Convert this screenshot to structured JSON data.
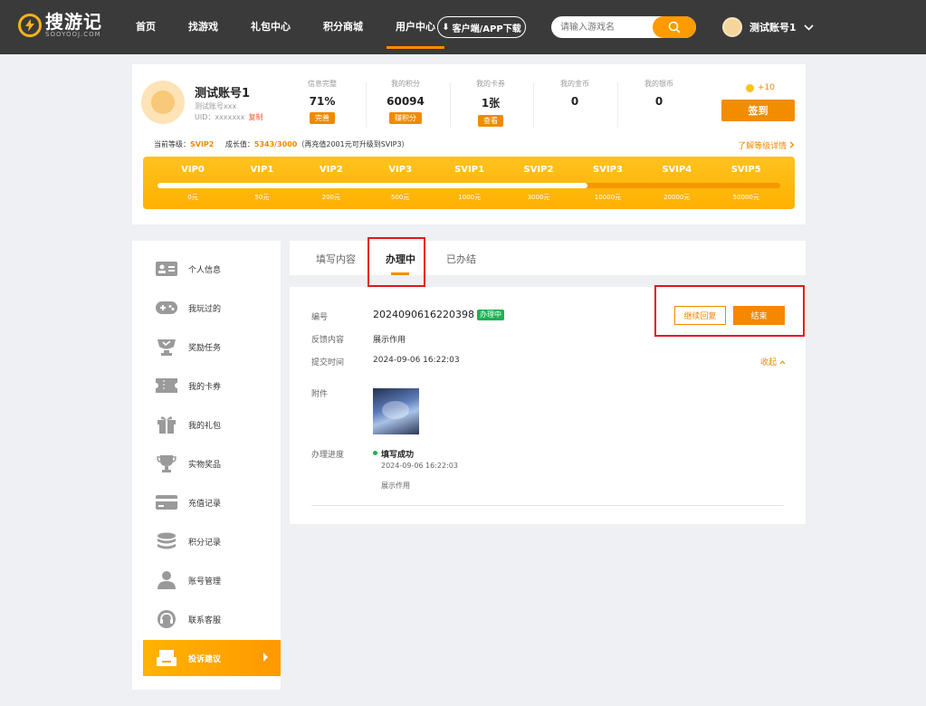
{
  "brand": {
    "name": "搜游记",
    "domain": "SOOYOOJ.COM",
    "color": "#f9b21a"
  },
  "nav": {
    "items": [
      {
        "label": "首页"
      },
      {
        "label": "找游戏"
      },
      {
        "label": "礼包中心"
      },
      {
        "label": "积分商城"
      },
      {
        "label": "用户中心",
        "active": true
      }
    ],
    "download_label": "客户端/APP下载",
    "search_placeholder": "请输入游戏名",
    "username": "测试账号1"
  },
  "profile": {
    "name": "测试账号1",
    "subtitle": "测试账号xxx",
    "uid_label": "UID：",
    "uid_value": "xxxxxxx",
    "copy_label": "复制",
    "stats": [
      {
        "label": "信息完整",
        "value": "71%",
        "button": "完善"
      },
      {
        "label": "我的积分",
        "value": "60094",
        "button": "赚积分"
      },
      {
        "label": "我的卡券",
        "value": "1张",
        "button": "查看"
      },
      {
        "label": "我的金币",
        "value": "0"
      },
      {
        "label": "我的银币",
        "value": "0"
      }
    ],
    "coin_bonus": "+10",
    "signin_label": "签到",
    "level_prefix": "当前等级：",
    "level": "SVIP2",
    "growth_prefix": "成长值：",
    "growth": "5343/3000",
    "growth_note": "（再充值2001元可升级到SVIP3）",
    "level_detail_label": "了解等级详情",
    "vip_levels": [
      {
        "name": "VIP0",
        "amount": "0元"
      },
      {
        "name": "VIP1",
        "amount": "50元"
      },
      {
        "name": "VIP2",
        "amount": "200元"
      },
      {
        "name": "VIP3",
        "amount": "500元"
      },
      {
        "name": "SVIP1",
        "amount": "1000元"
      },
      {
        "name": "SVIP2",
        "amount": "3000元"
      },
      {
        "name": "SVIP3",
        "amount": "10000元"
      },
      {
        "name": "SVIP4",
        "amount": "20000元"
      },
      {
        "name": "SVIP5",
        "amount": "50000元"
      }
    ],
    "vip_progress": 0.69,
    "accent_color": "#ff9a00"
  },
  "sidebar": {
    "items": [
      {
        "label": "个人信息",
        "icon": "id-card-icon"
      },
      {
        "label": "我玩过的",
        "icon": "gamepad-icon"
      },
      {
        "label": "奖励任务",
        "icon": "trophy-badge-icon"
      },
      {
        "label": "我的卡券",
        "icon": "ticket-icon"
      },
      {
        "label": "我的礼包",
        "icon": "gift-icon"
      },
      {
        "label": "实物奖品",
        "icon": "cup-icon"
      },
      {
        "label": "充值记录",
        "icon": "credit-card-icon"
      },
      {
        "label": "积分记录",
        "icon": "coins-stack-icon"
      },
      {
        "label": "账号管理",
        "icon": "user-icon"
      },
      {
        "label": "联系客服",
        "icon": "headset-icon"
      },
      {
        "label": "投诉建议",
        "icon": "inbox-icon",
        "active": true
      }
    ]
  },
  "tabs": [
    {
      "label": "填写内容"
    },
    {
      "label": "办理中",
      "active": true
    },
    {
      "label": "已办结"
    }
  ],
  "detail": {
    "id_label": "编号",
    "id_value": "2024090616220398",
    "status": "办理中",
    "status_color": "#1db152",
    "feedback_label": "反馈内容",
    "feedback_value": "展示作用",
    "submit_label": "提交时间",
    "submit_value": "2024-09-06 16:22:03",
    "collapse_label": "收起",
    "attachment_label": "附件",
    "progress_label": "办理进度",
    "progress_title": "填写成功",
    "progress_time": "2024-09-06 16:22:03",
    "progress_note": "展示作用",
    "reply_button": "继续回复",
    "end_button": "结束"
  }
}
